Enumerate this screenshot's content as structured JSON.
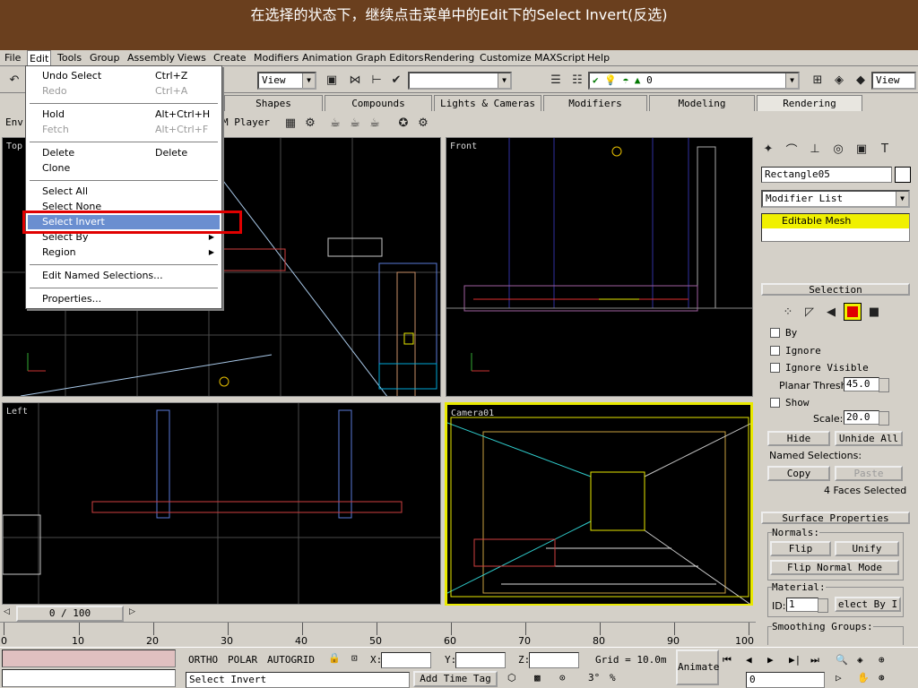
{
  "caption": "在选择的状态下，继续点击菜单中的Edit下的Select Invert(反选)",
  "menubar": {
    "items": [
      "File",
      "Edit",
      "Tools",
      "Group",
      "Assembly",
      "Views",
      "Create",
      "Modifiers",
      "Animation",
      "Graph Editors",
      "Rendering",
      "Customize",
      "MAXScript",
      "Help"
    ],
    "active": "Edit"
  },
  "toolbar": {
    "view_combo": "View",
    "layer_combo": "0",
    "right_view_combo": "View"
  },
  "tabs": [
    "Shapes",
    "Compounds",
    "Lights & Cameras",
    "Modifiers",
    "Modeling",
    "Rendering"
  ],
  "active_tab": "Rendering",
  "tabtools": {
    "env_label": "Env",
    "player_label": "M Player"
  },
  "edit_menu": {
    "items": [
      {
        "label": "Undo Select",
        "shortcut": "Ctrl+Z",
        "disabled": false
      },
      {
        "label": "Redo",
        "shortcut": "Ctrl+A",
        "disabled": true
      },
      {
        "label": "Hold",
        "shortcut": "Alt+Ctrl+H",
        "disabled": false
      },
      {
        "label": "Fetch",
        "shortcut": "Alt+Ctrl+F",
        "disabled": true
      },
      {
        "label": "Delete",
        "shortcut": "Delete",
        "disabled": false
      },
      {
        "label": "Clone",
        "shortcut": "",
        "disabled": false
      },
      {
        "label": "Select All",
        "shortcut": "",
        "disabled": false
      },
      {
        "label": "Select None",
        "shortcut": "",
        "disabled": false
      },
      {
        "label": "Select Invert",
        "shortcut": "",
        "disabled": false,
        "highlighted": true
      },
      {
        "label": "Select By",
        "shortcut": "",
        "submenu": true
      },
      {
        "label": "Region",
        "shortcut": "",
        "submenu": true
      },
      {
        "label": "Edit Named Selections...",
        "shortcut": ""
      },
      {
        "label": "Properties...",
        "shortcut": ""
      }
    ]
  },
  "viewports": {
    "top": "Top",
    "front": "Front",
    "left": "Left",
    "camera": "Camera01"
  },
  "command_panel": {
    "object_name": "Rectangle05",
    "modifier_list": "Modifier List",
    "stack_item": "Editable Mesh",
    "selection_title": "Selection",
    "by_label": "By",
    "ignore_label": "Ignore",
    "ignore_visible_label": "Ignore Visible",
    "planar_thresh_label": "Planar Thresh:",
    "planar_thresh_value": "45.0",
    "show_label": "Show",
    "scale_label": "Scale:",
    "scale_value": "20.0",
    "hide_label": "Hide",
    "unhide_all_label": "Unhide All",
    "named_selections_label": "Named Selections:",
    "copy_label": "Copy",
    "paste_label": "Paste",
    "faces_selected": "4 Faces Selected",
    "surface_title": "Surface Properties",
    "normals_label": "Normals:",
    "flip_label": "Flip",
    "unify_label": "Unify",
    "flip_normal_mode_label": "Flip Normal Mode",
    "material_label": "Material:",
    "id_label": "ID:",
    "id_value": "1",
    "select_by_id_label": "elect By I",
    "smoothing_label": "Smoothing Groups:"
  },
  "timeline": {
    "frame_display": "0 / 100",
    "ruler_ticks": [
      "0",
      "10",
      "20",
      "30",
      "40",
      "50",
      "60",
      "70",
      "80",
      "90",
      "100"
    ]
  },
  "statusbar": {
    "ortho": "ORTHO",
    "polar": "POLAR",
    "autogrid": "AUTOGRID",
    "x_label": "X:",
    "y_label": "Y:",
    "z_label": "Z:",
    "grid": "Grid = 10.0m",
    "animate": "Animate",
    "prompt": "Select Invert",
    "add_time_tag": "Add Time Tag",
    "frame_value": "0"
  }
}
